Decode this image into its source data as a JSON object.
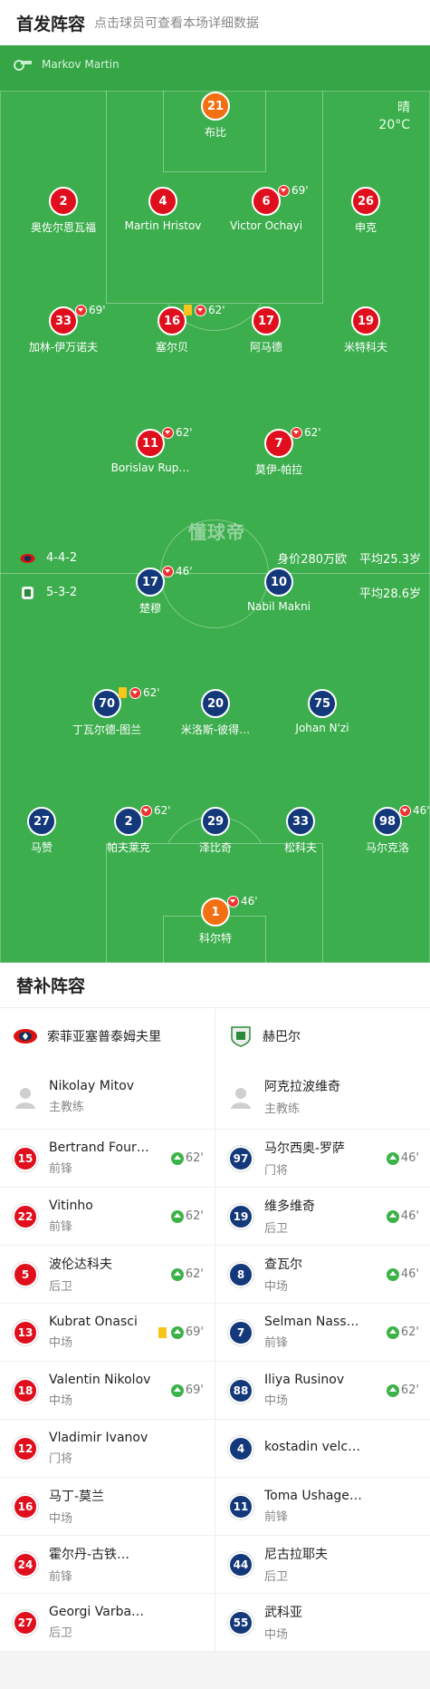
{
  "header": {
    "title": "首发阵容",
    "subtitle": "点击球员可查看本场详细数据"
  },
  "referee": "Markov Martin",
  "weather": {
    "condition": "晴",
    "temperature": "20°C"
  },
  "watermark": "懂球帝",
  "colors": {
    "home": "#e00f1d",
    "away": "#14397a",
    "goalkeeper_home": "#f36f14",
    "pitch": "#3cae4d",
    "sub_in": "#3db247"
  },
  "home_team_bar": {
    "formation": "4-4-2",
    "value": "身价280万欧",
    "avg_age": "平均25.3岁"
  },
  "away_team_bar": {
    "formation": "5-3-2",
    "avg_age": "平均28.6岁"
  },
  "home_players": [
    {
      "num": "21",
      "name": "布比",
      "color": "orange",
      "events": {}
    },
    {
      "num": "2",
      "name": "奥佐尔恩瓦福",
      "color": "red",
      "events": {}
    },
    {
      "num": "4",
      "name": "Martin Hristov",
      "color": "red",
      "events": {}
    },
    {
      "num": "6",
      "name": "Victor Ochayi",
      "color": "red",
      "events": {
        "sub_out": "69'",
        "own_goal": true
      }
    },
    {
      "num": "26",
      "name": "申克",
      "color": "red",
      "events": {
        "goal": true
      }
    },
    {
      "num": "33",
      "name": "加林-伊万诺夫",
      "color": "red",
      "events": {
        "sub_out": "69'",
        "goal": true
      }
    },
    {
      "num": "16",
      "name": "塞尔贝",
      "color": "red",
      "events": {
        "yellow": true,
        "sub_out": "62'",
        "goal": true
      }
    },
    {
      "num": "17",
      "name": "阿马德",
      "color": "red",
      "events": {
        "goal": true
      }
    },
    {
      "num": "19",
      "name": "米特科夫",
      "color": "red",
      "events": {
        "goal": true,
        "own_goal": true
      }
    },
    {
      "num": "11",
      "name": "Borislav Rup…",
      "color": "red",
      "events": {
        "sub_out": "62'",
        "goal": true
      }
    },
    {
      "num": "7",
      "name": "莫伊-帕拉",
      "color": "red",
      "events": {
        "sub_out": "62'",
        "own_goal": true
      }
    }
  ],
  "away_players": [
    {
      "num": "17",
      "name": "楚穆",
      "color": "blue",
      "events": {
        "sub_out": "46'"
      }
    },
    {
      "num": "10",
      "name": "Nabil Makni",
      "color": "blue",
      "events": {}
    },
    {
      "num": "70",
      "name": "丁瓦尔德-图兰",
      "color": "blue",
      "events": {
        "yellow": true,
        "sub_out": "62'"
      }
    },
    {
      "num": "20",
      "name": "米洛斯-彼得…",
      "color": "blue",
      "events": {}
    },
    {
      "num": "75",
      "name": "Johan N'zi",
      "color": "blue",
      "events": {
        "own_goal": true
      }
    },
    {
      "num": "27",
      "name": "马赞",
      "color": "blue",
      "events": {
        "goal": true
      }
    },
    {
      "num": "2",
      "name": "帕夫莱克",
      "color": "blue",
      "events": {
        "sub_out": "62'"
      }
    },
    {
      "num": "29",
      "name": "泽比奇",
      "color": "blue",
      "events": {}
    },
    {
      "num": "33",
      "name": "松科夫",
      "color": "blue",
      "events": {}
    },
    {
      "num": "98",
      "name": "马尔克洛",
      "color": "blue",
      "events": {
        "sub_out": "46'"
      }
    },
    {
      "num": "1",
      "name": "科尔特",
      "color": "orange",
      "events": {
        "sub_out": "46'"
      }
    }
  ],
  "subs_section": {
    "title": "替补阵容",
    "home": {
      "team_name": "索菲亚塞普泰姆夫里",
      "coach": {
        "name": "Nikolay Mitov",
        "role": "主教练"
      },
      "players": [
        {
          "num": "15",
          "name": "Bertrand Four…",
          "pos": "前锋",
          "sub_in": "62'"
        },
        {
          "num": "22",
          "name": "Vitinho",
          "pos": "前锋",
          "sub_in": "62'"
        },
        {
          "num": "5",
          "name": "波伦达科夫",
          "pos": "后卫",
          "sub_in": "62'"
        },
        {
          "num": "13",
          "name": "Kubrat Onasci",
          "pos": "中场",
          "sub_in": "69'",
          "yellow": true
        },
        {
          "num": "18",
          "name": "Valentin Nikolov",
          "pos": "中场",
          "sub_in": "69'"
        },
        {
          "num": "12",
          "name": "Vladimir Ivanov",
          "pos": "门将"
        },
        {
          "num": "16",
          "name": "马丁-莫兰",
          "pos": "中场"
        },
        {
          "num": "24",
          "name": "霍尔丹-古铁…",
          "pos": "前锋"
        },
        {
          "num": "27",
          "name": "Georgi Varba…",
          "pos": "后卫"
        }
      ]
    },
    "away": {
      "team_name": "赫巴尔",
      "coach": {
        "name": "阿克拉波维奇",
        "role": "主教练"
      },
      "players": [
        {
          "num": "97",
          "name": "马尔西奥-罗萨",
          "pos": "门将",
          "sub_in": "46'"
        },
        {
          "num": "19",
          "name": "维多维奇",
          "pos": "后卫",
          "sub_in": "46'"
        },
        {
          "num": "8",
          "name": "查瓦尔",
          "pos": "中场",
          "sub_in": "46'"
        },
        {
          "num": "7",
          "name": "Selman Nass…",
          "pos": "前锋",
          "sub_in": "62'"
        },
        {
          "num": "88",
          "name": "Iliya Rusinov",
          "pos": "中场",
          "sub_in": "62'"
        },
        {
          "num": "4",
          "name": "kostadin velc…",
          "pos": ""
        },
        {
          "num": "11",
          "name": "Toma Ushage…",
          "pos": "前锋"
        },
        {
          "num": "44",
          "name": "尼古拉耶夫",
          "pos": "后卫"
        },
        {
          "num": "55",
          "name": "武科亚",
          "pos": "中场"
        }
      ]
    }
  }
}
